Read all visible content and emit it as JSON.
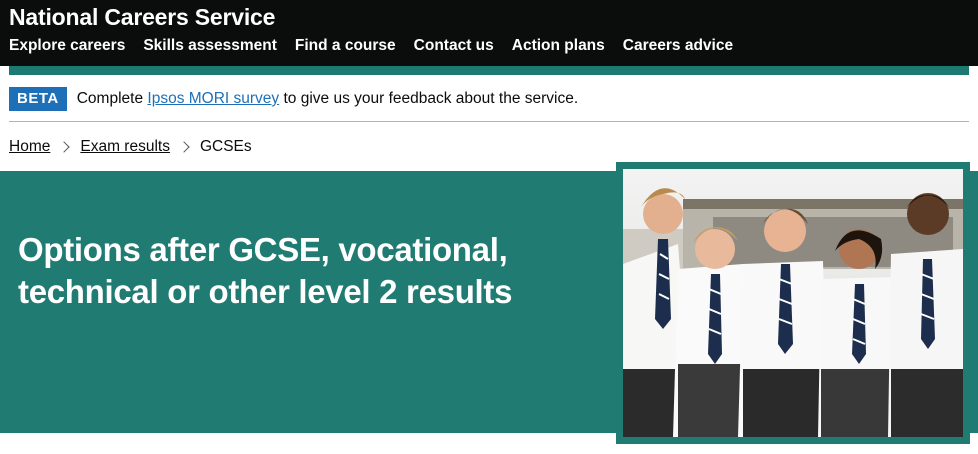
{
  "header": {
    "site_title": "National Careers Service",
    "nav": [
      "Explore careers",
      "Skills assessment",
      "Find a course",
      "Contact us",
      "Action plans",
      "Careers advice"
    ]
  },
  "beta_banner": {
    "tag": "BETA",
    "text_before": "Complete ",
    "link": "Ipsos MORI survey",
    "text_after": " to give us your feedback about the service."
  },
  "breadcrumb": [
    "Home",
    "Exam results",
    "GCSEs"
  ],
  "hero": {
    "title": "Options after GCSE, vocational, technical or other level 2 results"
  },
  "colors": {
    "header_bg": "#0b0c0c",
    "teal": "#207c73",
    "beta_blue": "#1d70b8",
    "link": "#1d70b8"
  },
  "icons": [
    "chevron-right-icon"
  ]
}
